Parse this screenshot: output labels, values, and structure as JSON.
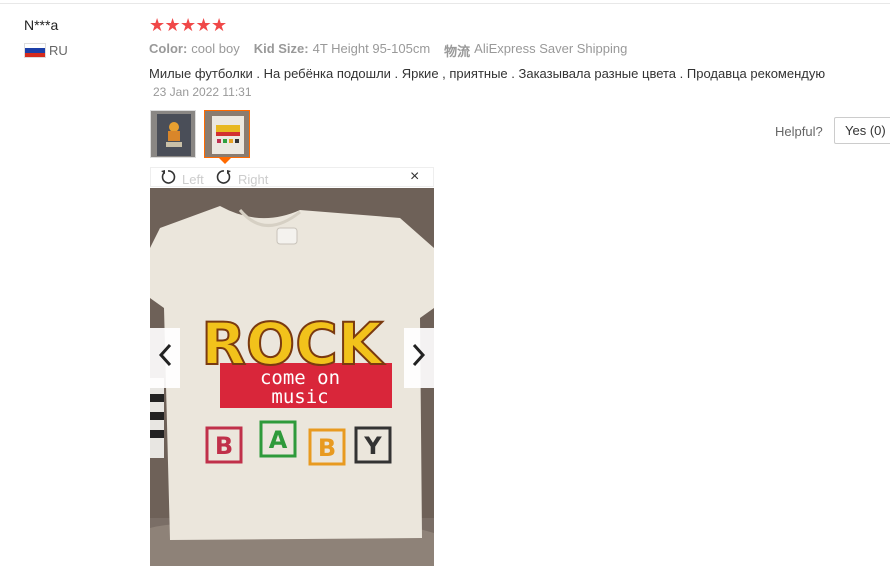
{
  "review": {
    "user_name": "N***a",
    "country_code": "RU",
    "rating": 5,
    "stars": [
      "★",
      "★",
      "★",
      "★",
      "★"
    ],
    "attributes": [
      {
        "key": "Color:",
        "value": "cool boy"
      },
      {
        "key": "Kid Size:",
        "value": "4T Height 95-105cm"
      },
      {
        "key": "物流",
        "value": "AliExpress Saver Shipping"
      }
    ],
    "text": "Милые футболки . На ребёнка подошли . Яркие , приятные . Заказывала разные цвета . Продавца рекомендую",
    "date": "23 Jan 2022 11:31"
  },
  "helpful": {
    "label": "Helpful?",
    "yes_label": "Yes (0)"
  },
  "viewer": {
    "rotate_left": "Left",
    "rotate_right": "Right",
    "close": "×",
    "prev": "‹",
    "next": "›",
    "shirt_print": {
      "headline": "ROCK",
      "banner_line1": "come on",
      "banner_line2": "music",
      "blocks": [
        "B",
        "A",
        "B",
        "Y"
      ]
    }
  },
  "colors": {
    "star": "#f04848",
    "accent": "#ff6a00",
    "flag": [
      "#ffffff",
      "#1c3fa8",
      "#d52b1e"
    ]
  }
}
